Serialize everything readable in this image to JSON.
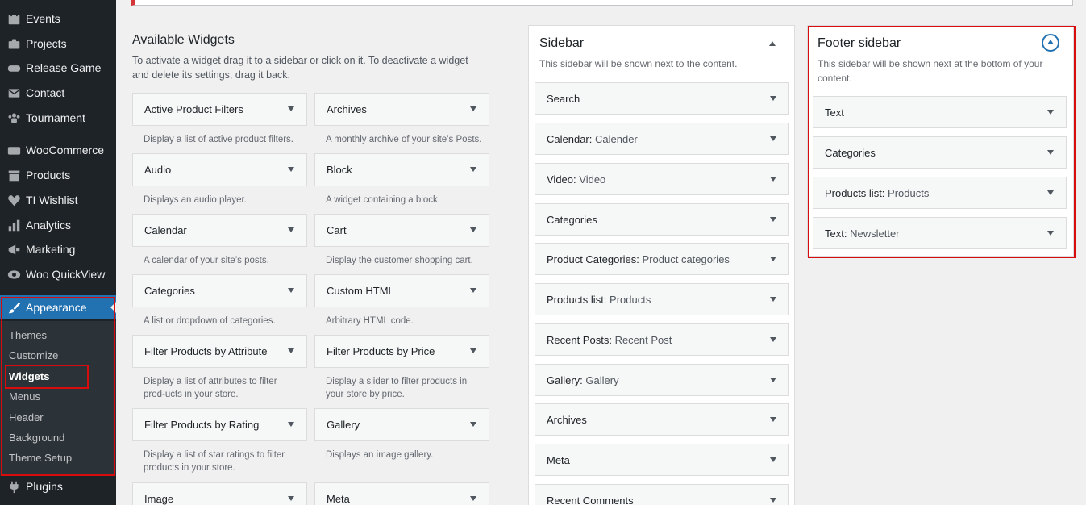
{
  "menu": {
    "items": [
      {
        "label": "Events",
        "icon": "calendar-icon"
      },
      {
        "label": "Projects",
        "icon": "portfolio-icon"
      },
      {
        "label": "Release Game",
        "icon": "gamepad-icon"
      },
      {
        "label": "Contact",
        "icon": "email-icon"
      },
      {
        "label": "Tournament",
        "icon": "groups-icon"
      },
      {
        "label": "WooCommerce",
        "icon": "woocommerce-icon"
      },
      {
        "label": "Products",
        "icon": "archive-icon"
      },
      {
        "label": "TI Wishlist",
        "icon": "heart-icon"
      },
      {
        "label": "Analytics",
        "icon": "chart-bar-icon"
      },
      {
        "label": "Marketing",
        "icon": "megaphone-icon"
      },
      {
        "label": "Woo QuickView",
        "icon": "eye-icon"
      }
    ],
    "appearance": {
      "label": "Appearance",
      "icon": "paintbrush-icon"
    },
    "submenu": [
      "Themes",
      "Customize",
      "Widgets",
      "Menus",
      "Header",
      "Background",
      "Theme Setup"
    ],
    "plugins": {
      "label": "Plugins",
      "icon": "plugin-icon"
    }
  },
  "available": {
    "title": "Available Widgets",
    "description": "To activate a widget drag it to a sidebar or click on it. To deactivate a widget and delete its settings, drag it back.",
    "widgets": [
      {
        "title": "Active Product Filters",
        "desc": "Display a list of active product filters."
      },
      {
        "title": "Archives",
        "desc": "A monthly archive of your site’s Posts."
      },
      {
        "title": "Audio",
        "desc": "Displays an audio player."
      },
      {
        "title": "Block",
        "desc": "A widget containing a block."
      },
      {
        "title": "Calendar",
        "desc": "A calendar of your site’s posts."
      },
      {
        "title": "Cart",
        "desc": "Display the customer shopping cart."
      },
      {
        "title": "Categories",
        "desc": "A list or dropdown of categories."
      },
      {
        "title": "Custom HTML",
        "desc": "Arbitrary HTML code."
      },
      {
        "title": "Filter Products by Attribute",
        "desc": "Display a list of attributes to filter prod-ucts in your store."
      },
      {
        "title": "Filter Products by Price",
        "desc": "Display a slider to filter products in your store by price."
      },
      {
        "title": "Filter Products by Rating",
        "desc": "Display a list of star ratings to filter products in your store."
      },
      {
        "title": "Gallery",
        "desc": "Displays an image gallery."
      },
      {
        "title": "Image",
        "desc": ""
      },
      {
        "title": "Meta",
        "desc": ""
      }
    ]
  },
  "sidebar": {
    "title": "Sidebar",
    "description": "This sidebar will be shown next to the content.",
    "widgets": [
      {
        "title": "Search",
        "sub": ""
      },
      {
        "title": "Calendar:",
        "sub": "Calender"
      },
      {
        "title": "Video:",
        "sub": "Video"
      },
      {
        "title": "Categories",
        "sub": ""
      },
      {
        "title": "Product Categories:",
        "sub": "Product categories"
      },
      {
        "title": "Products list:",
        "sub": "Products"
      },
      {
        "title": "Recent Posts:",
        "sub": "Recent Post"
      },
      {
        "title": "Gallery:",
        "sub": "Gallery"
      },
      {
        "title": "Archives",
        "sub": ""
      },
      {
        "title": "Meta",
        "sub": ""
      },
      {
        "title": "Recent Comments",
        "sub": ""
      }
    ]
  },
  "footer_sidebar": {
    "title": "Footer sidebar",
    "description": "This sidebar will be shown next at the bottom of your content.",
    "widgets": [
      {
        "title": "Text",
        "sub": ""
      },
      {
        "title": "Categories",
        "sub": ""
      },
      {
        "title": "Products list:",
        "sub": "Products"
      },
      {
        "title": "Text:",
        "sub": "Newsletter"
      }
    ]
  },
  "colors": {
    "accent": "#2271b1",
    "highlight": "#d80c0c",
    "menu_bg": "#1d2327"
  }
}
